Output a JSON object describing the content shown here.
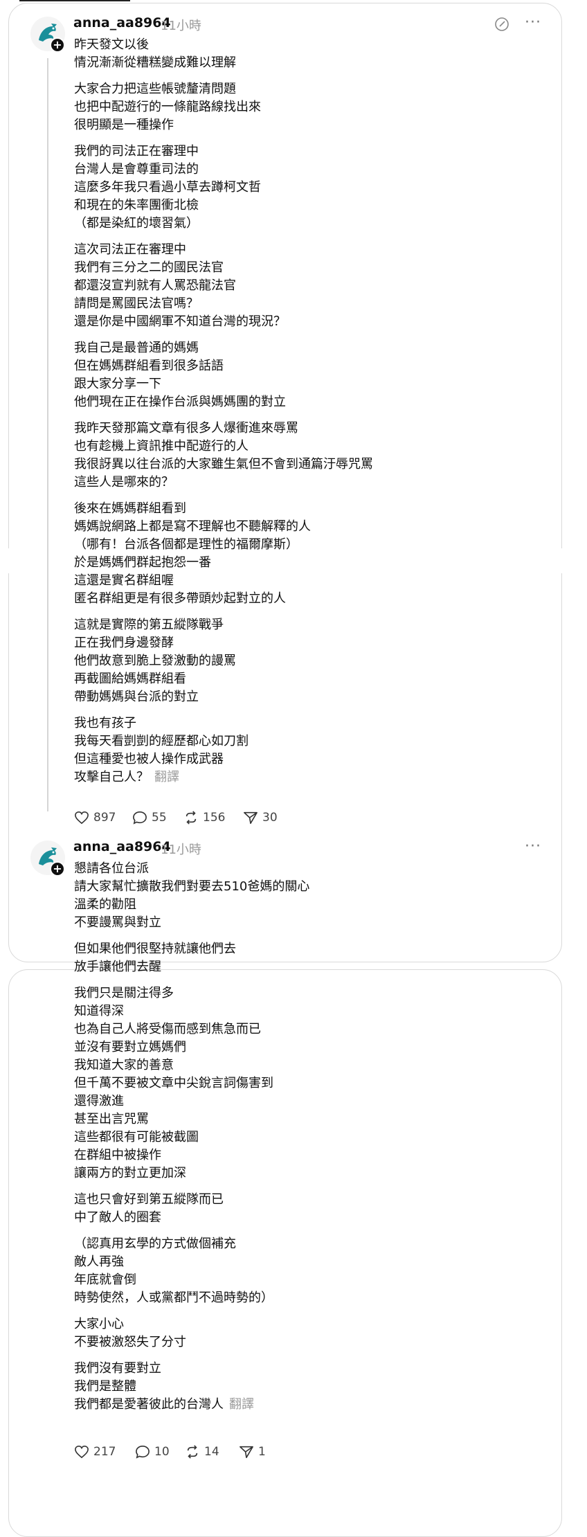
{
  "posts": [
    {
      "username": "anna_aa8964",
      "time": "11小時",
      "paragraphs": [
        [
          "昨天發文以後",
          "情況漸漸從糟糕變成難以理解"
        ],
        [
          "大家合力把這些帳號釐清問題",
          "也把中配遊行的一條龍路線找出來",
          "很明顯是一種操作"
        ],
        [
          "我們的司法正在審理中",
          "台灣人是會尊重司法的",
          "這麼多年我只看過小草去蹲柯文哲",
          "和現在的朱率團衝北檢",
          "（都是染紅的壞習氣）"
        ],
        [
          "這次司法正在審理中",
          "我們有三分之二的國民法官",
          "都還沒宣判就有人罵恐龍法官",
          "請問是罵國民法官嗎？",
          "還是你是中國網軍不知道台灣的現況？"
        ],
        [
          "我自己是最普通的媽媽",
          "但在媽媽群組看到很多話語",
          "跟大家分享一下",
          "他們現在正在操作台派與媽媽團的對立"
        ],
        [
          "我昨天發那篇文章有很多人爆衝進來辱罵",
          "也有趁機上資訊推中配遊行的人",
          "我很訝異以往台派的大家雖生氣但不會到通篇汙辱咒罵",
          "這些人是哪來的？"
        ],
        [
          "後來在媽媽群組看到",
          "媽媽說網路上都是寫不理解也不聽解釋的人",
          "（哪有！台派各個都是理性的福爾摩斯）",
          "於是媽媽們群起抱怨一番",
          "這還是實名群組喔",
          "匿名群組更是有很多帶頭炒起對立的人"
        ],
        [
          "這就是實際的第五縱隊戰爭",
          "正在我們身邊發酵",
          "他們故意到脆上發激動的謾罵",
          "再截圖給媽媽群組看",
          "帶動媽媽與台派的對立"
        ],
        [
          "我也有孩子",
          "我每天看剴剴的經歷都心如刀割",
          "但這種愛也被人操作成武器",
          "攻擊自己人？"
        ]
      ],
      "translate": "翻譯",
      "likes": "897",
      "replies": "55",
      "reposts": "156",
      "shares": "30"
    },
    {
      "username": "anna_aa8964",
      "time": "11小時",
      "paragraphs": [
        [
          "懇請各位台派",
          "請大家幫忙擴散我們對要去510爸媽的關心",
          "溫柔的勸阻",
          "不要謾罵與對立"
        ],
        [
          "但如果他們很堅持就讓他們去",
          "放手讓他們去醒"
        ],
        [
          "我們只是關注得多",
          "知道得深",
          "也為自己人將受傷而感到焦急而已",
          "並沒有要對立媽媽們",
          "我知道大家的善意",
          "但千萬不要被文章中尖銳言詞傷害到",
          "還得激進",
          "甚至出言咒罵",
          "這些都很有可能被截圖",
          "在群組中被操作",
          "讓兩方的對立更加深"
        ],
        [
          "這也只會好到第五縱隊而已",
          "中了敵人的圈套"
        ],
        [
          "（認真用玄學的方式做個補充",
          "敵人再強",
          "年底就會倒",
          "時勢使然，人或黨都鬥不過時勢的）"
        ],
        [
          "大家小心",
          "不要被激怒失了分寸"
        ],
        [
          "我們沒有要對立",
          "我們是整體",
          "我們都是愛著彼此的台灣人"
        ]
      ],
      "translate": "翻譯",
      "likes": "217",
      "replies": "10",
      "reposts": "14",
      "shares": "1"
    }
  ],
  "colors": {
    "text": "#101010",
    "muted": "#9a9a9a",
    "border": "#d9d9d9",
    "avatar_accent": "#1a8f9a"
  },
  "icons": [
    "compose-icon",
    "more-icon",
    "heart-icon",
    "reply-icon",
    "repost-icon",
    "share-icon"
  ]
}
